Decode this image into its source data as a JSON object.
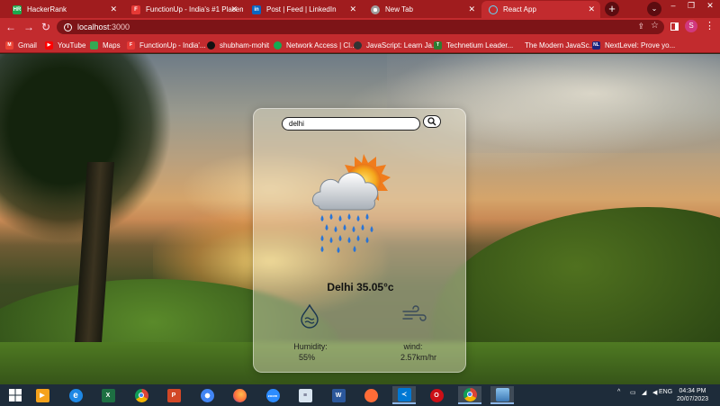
{
  "browser": {
    "tabs": [
      {
        "title": "HackerRank",
        "favicon": "hackerrank-icon",
        "color": "#1ba94c",
        "glyph": "HR",
        "active": false
      },
      {
        "title": "FunctionUp - India's #1 Placem",
        "favicon": "functionup-icon",
        "color": "#e53935",
        "glyph": "F",
        "active": false
      },
      {
        "title": "Post | Feed | LinkedIn",
        "favicon": "linkedin-icon",
        "color": "#0a66c2",
        "glyph": "in",
        "active": false
      },
      {
        "title": "New Tab",
        "favicon": "chrome-icon",
        "color": "#9e9e9e",
        "glyph": "",
        "active": false
      },
      {
        "title": "React App",
        "favicon": "react-icon",
        "color": "#61dafb",
        "glyph": "",
        "active": true
      }
    ],
    "new_tab": "+",
    "url_host": "localhost",
    "url_port": ":3000",
    "profile_initial": "S",
    "bookmarks": [
      {
        "label": "Gmail",
        "icon": "gmail-icon",
        "color": "#ea4335"
      },
      {
        "label": "YouTube",
        "icon": "youtube-icon",
        "color": "#ff0000"
      },
      {
        "label": "Maps",
        "icon": "maps-icon",
        "color": "#34a853"
      },
      {
        "label": "FunctionUp - India'...",
        "icon": "functionup-icon",
        "color": "#e53935"
      },
      {
        "label": "shubham-mohit",
        "icon": "github-icon",
        "color": "#111111"
      },
      {
        "label": "Network Access | Cl...",
        "icon": "mongodb-icon",
        "color": "#13aa52"
      },
      {
        "label": "JavaScript: Learn Ja...",
        "icon": "javascript-icon",
        "color": "#333333"
      },
      {
        "label": "Technetium Leader...",
        "icon": "technetium-icon",
        "color": "#2e7d32"
      },
      {
        "label": "The Modern JavaSc...",
        "icon": "modern-js-icon",
        "color": "#c22b2e"
      },
      {
        "label": "NextLevel: Prove yo...",
        "icon": "nextlevel-icon",
        "color": "#1a237e"
      }
    ]
  },
  "weather_app": {
    "search_value": "delhi",
    "search_placeholder": "",
    "city_temp": "Delhi 35.05°c",
    "humidity_label": "Humidity:",
    "humidity_value": "55%",
    "wind_label": "wind:",
    "wind_value": "2.57km/hr"
  },
  "taskbar": {
    "language": "ENG",
    "time": "04:34 PM",
    "date": "20/07/2023",
    "apps": [
      {
        "name": "windows-start-icon",
        "color": "#ffffff",
        "glyph": "",
        "active": false
      },
      {
        "name": "media-player-icon",
        "color": "#f6a21b",
        "glyph": "▶",
        "active": false
      },
      {
        "name": "internet-explorer-icon",
        "color": "#1e88e5",
        "glyph": "e",
        "active": false
      },
      {
        "name": "excel-icon",
        "color": "#1d6f42",
        "glyph": "X",
        "active": false
      },
      {
        "name": "chrome-icon",
        "color": "#db4437",
        "glyph": "",
        "active": false
      },
      {
        "name": "powerpoint-icon",
        "color": "#d24726",
        "glyph": "P",
        "active": false
      },
      {
        "name": "chromium-icon",
        "color": "#4285f4",
        "glyph": "",
        "active": false
      },
      {
        "name": "firefox-icon",
        "color": "#ff7139",
        "glyph": "",
        "active": false
      },
      {
        "name": "zoom-icon",
        "color": "#2d8cff",
        "glyph": "zoom",
        "active": false
      },
      {
        "name": "notepad-icon",
        "color": "#4a8bc8",
        "glyph": "≡",
        "active": false
      },
      {
        "name": "word-icon",
        "color": "#2b579a",
        "glyph": "W",
        "active": false
      },
      {
        "name": "postman-icon",
        "color": "#ff6c37",
        "glyph": "",
        "active": false
      },
      {
        "name": "vscode-icon",
        "color": "#0078d4",
        "glyph": "",
        "active": false
      },
      {
        "name": "opera-icon",
        "color": "#cc0f16",
        "glyph": "O",
        "active": false
      },
      {
        "name": "chrome-active-icon",
        "color": "#db4437",
        "glyph": "",
        "active": true
      },
      {
        "name": "photos-icon",
        "color": "#5fa0d8",
        "glyph": "",
        "active": false
      }
    ]
  }
}
